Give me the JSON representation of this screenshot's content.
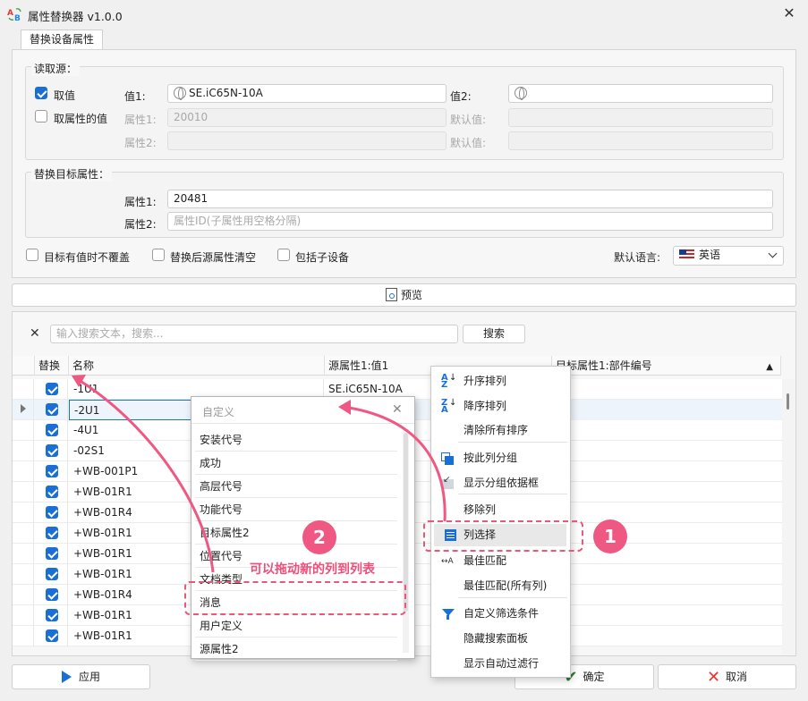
{
  "window": {
    "title": "属性替换器 v1.0.0",
    "tab_label": "替换设备属性"
  },
  "read_source": {
    "group_title": "读取源：",
    "take_value_label": "取值",
    "take_attr_value_label": "取属性的值",
    "value1_label": "值1:",
    "value1": "SE.iC65N-10A",
    "value2_label": "值2:",
    "value2": "",
    "attr1_label": "属性1:",
    "attr1": "20010",
    "default1_label": "默认值:",
    "attr2_label": "属性2:",
    "default2_label": "默认值:"
  },
  "target": {
    "group_title": "替换目标属性：",
    "attr1_label": "属性1:",
    "attr1": "20481",
    "attr2_label": "属性2:",
    "attr2_placeholder": "属性ID(子属性用空格分隔)"
  },
  "options": {
    "no_overwrite": "目标有值时不覆盖",
    "clear_source": "替换后源属性清空",
    "include_children": "包括子设备",
    "lang_label": "默认语言:",
    "lang_value": "英语"
  },
  "preview_label": "预览",
  "search": {
    "placeholder": "输入搜索文本，搜索...",
    "button": "搜索"
  },
  "grid": {
    "headers": [
      "替换",
      "名称",
      "源属性1:值1",
      "目标属性1:部件编号"
    ],
    "rows": [
      {
        "name": "-1U1",
        "src": "SE.iC65N-10A"
      },
      {
        "name": "-2U1",
        "src": ""
      },
      {
        "name": "-4U1",
        "src": ""
      },
      {
        "name": "-02S1",
        "src": ""
      },
      {
        "name": "+WB-001P1",
        "src": ""
      },
      {
        "name": "+WB-01R1",
        "src": ""
      },
      {
        "name": "+WB-01R4",
        "src": ""
      },
      {
        "name": "+WB-01R1",
        "src": ""
      },
      {
        "name": "+WB-01R1",
        "src": ""
      },
      {
        "name": "+WB-01R1",
        "src": ""
      },
      {
        "name": "+WB-01R4",
        "src": ""
      },
      {
        "name": "+WB-01R1",
        "src": ""
      },
      {
        "name": "+WB-01R1",
        "src": ""
      }
    ]
  },
  "custom_popup": {
    "title": "自定义",
    "items": [
      "安装代号",
      "成功",
      "高层代号",
      "功能代号",
      "目标属性2",
      "位置代号",
      "文档类型",
      "消息",
      "用户定义",
      "源属性2"
    ]
  },
  "context_menu": {
    "items": [
      "升序排列",
      "降序排列",
      "清除所有排序",
      "按此列分组",
      "显示分组依据框",
      "移除列",
      "列选择",
      "最佳匹配",
      "最佳匹配(所有列)",
      "自定义筛选条件",
      "隐藏搜索面板",
      "显示自动过滤行"
    ]
  },
  "annotations": {
    "badge1": "1",
    "badge2": "2",
    "drag_hint": "可以拖动新的列到列表"
  },
  "footer": {
    "apply": "应用",
    "ok": "确定",
    "cancel": "取消"
  },
  "colors": {
    "accent": "#1a6fd6",
    "annotation": "#ef5882"
  }
}
